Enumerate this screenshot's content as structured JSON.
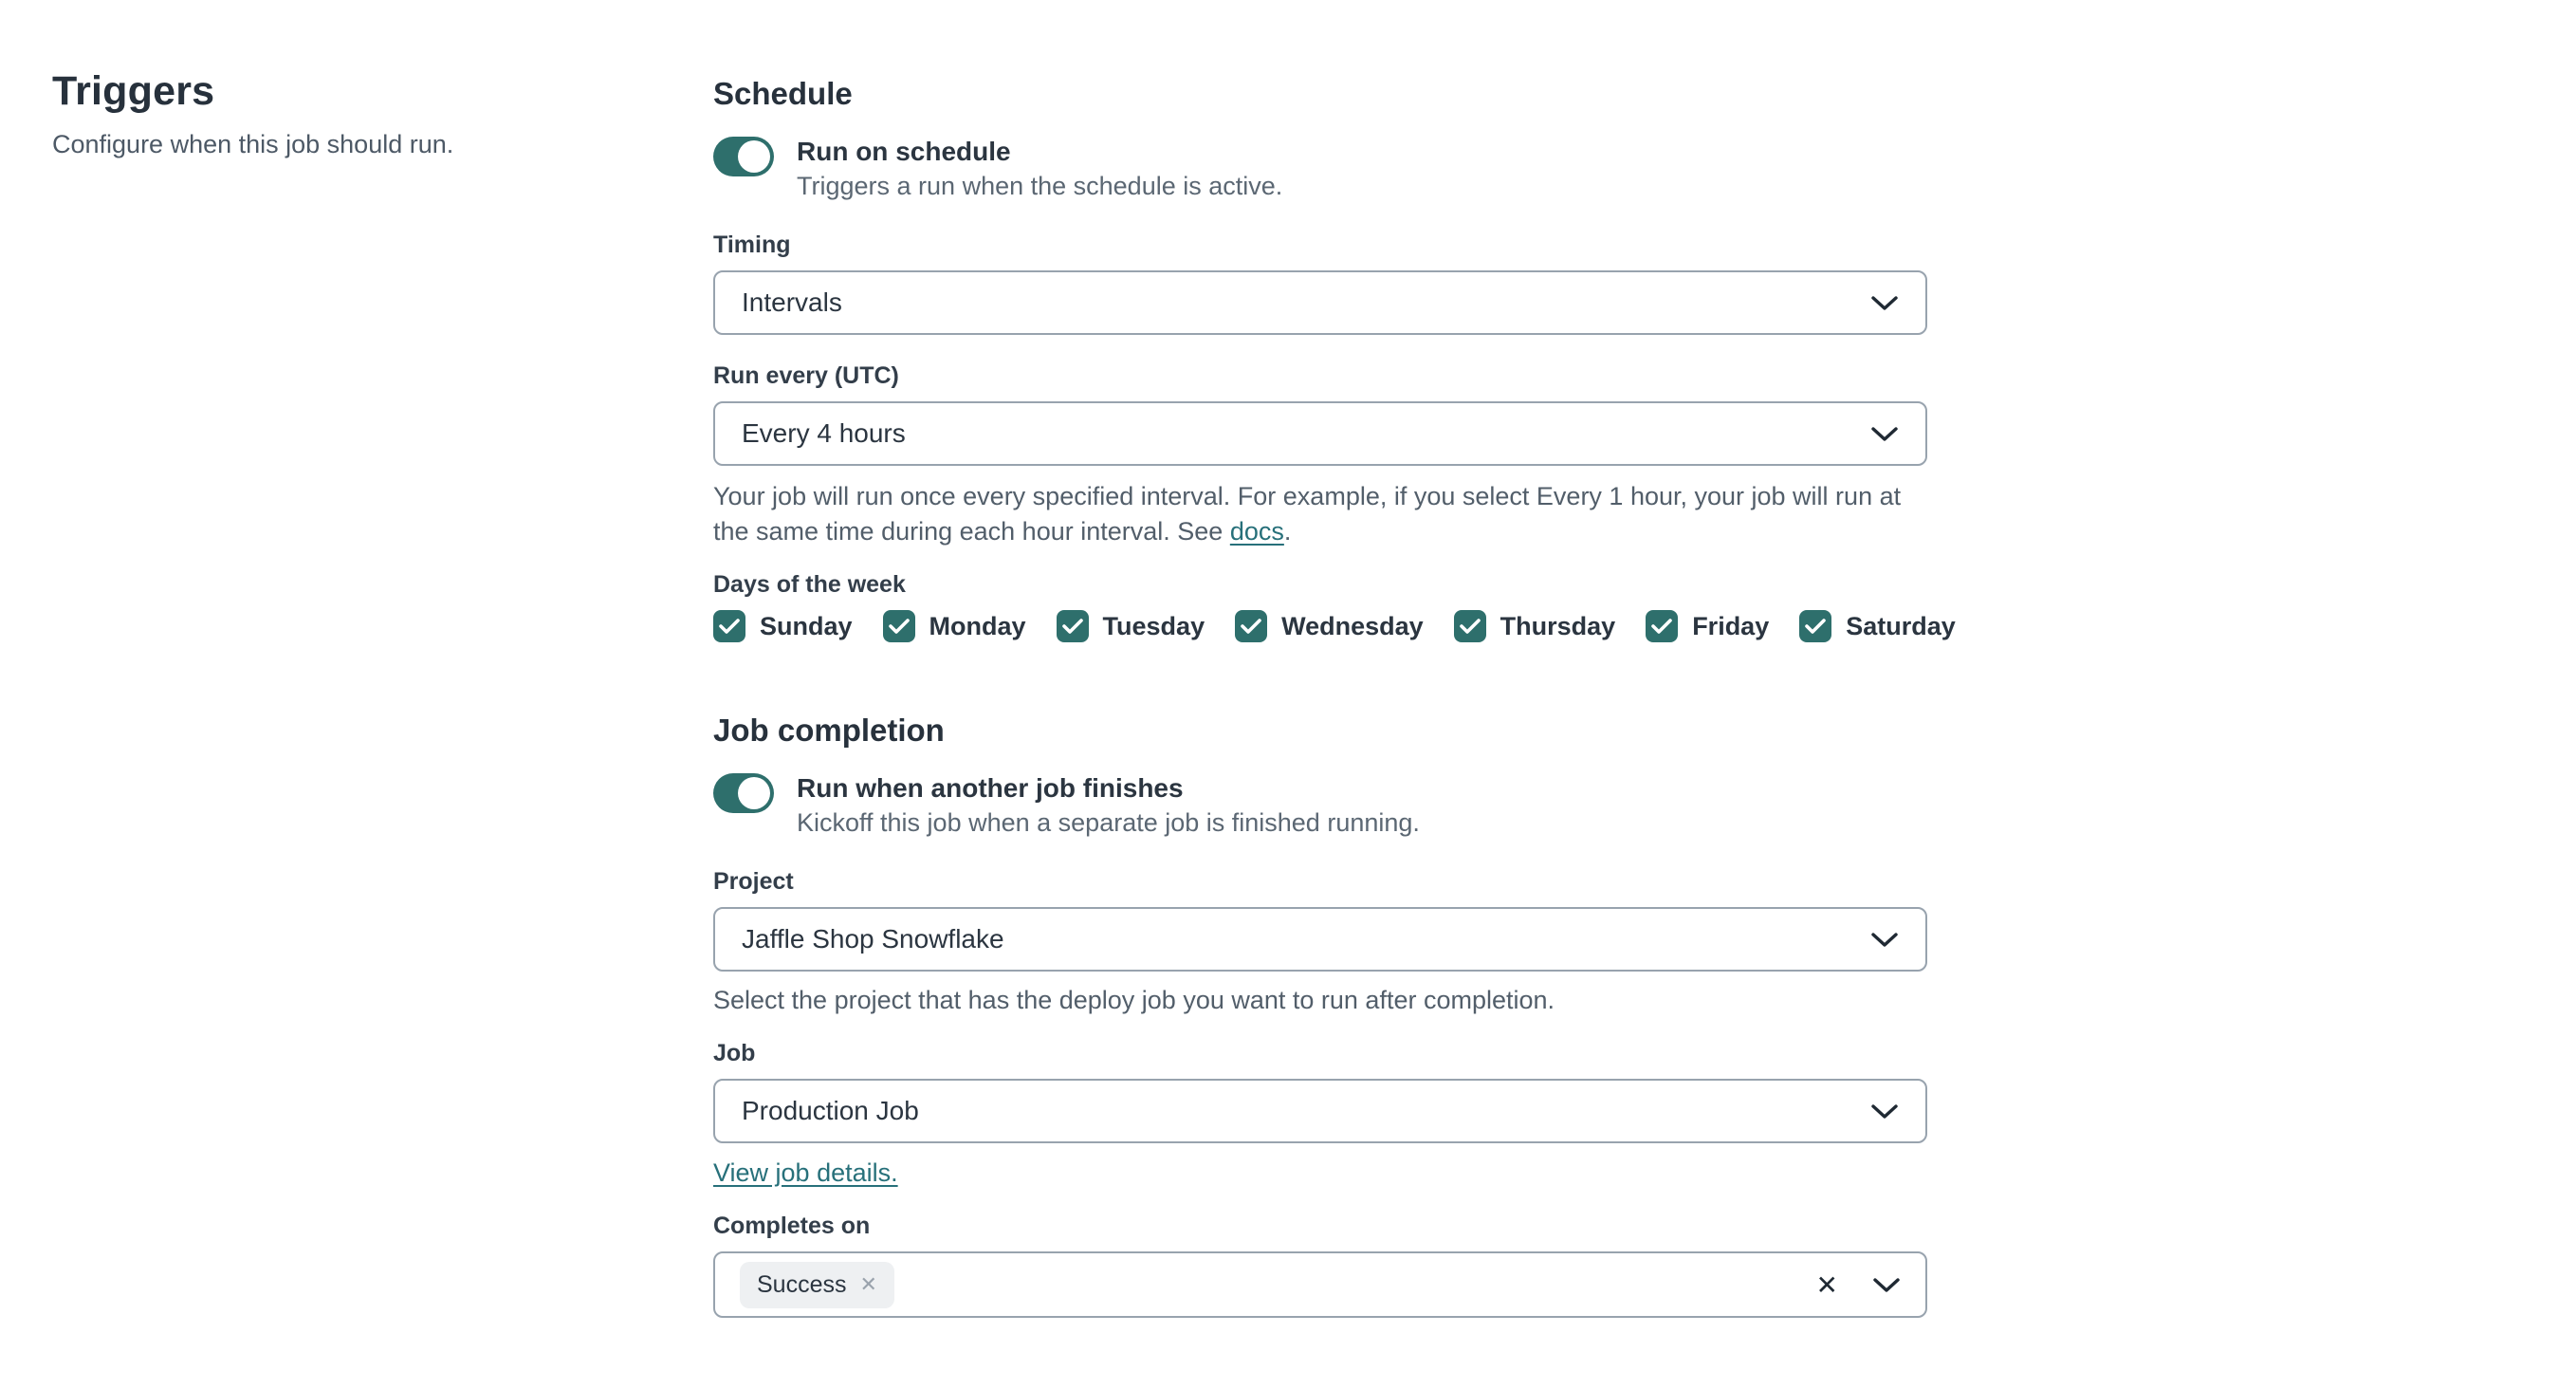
{
  "sidebar": {
    "title": "Triggers",
    "description": "Configure when this job should run."
  },
  "schedule": {
    "heading": "Schedule",
    "toggle": {
      "state": "on",
      "label": "Run on schedule",
      "description": "Triggers a run when the schedule is active."
    },
    "timing": {
      "label": "Timing",
      "value": "Intervals"
    },
    "run_every": {
      "label": "Run every (UTC)",
      "value": "Every 4 hours",
      "help_prefix": "Your job will run once every specified interval. For example, if you select Every 1 hour, your job will run at the same time during each hour interval. See ",
      "help_link": "docs",
      "help_suffix": "."
    },
    "days": {
      "label": "Days of the week",
      "items": [
        {
          "label": "Sunday",
          "checked": true
        },
        {
          "label": "Monday",
          "checked": true
        },
        {
          "label": "Tuesday",
          "checked": true
        },
        {
          "label": "Wednesday",
          "checked": true
        },
        {
          "label": "Thursday",
          "checked": true
        },
        {
          "label": "Friday",
          "checked": true
        },
        {
          "label": "Saturday",
          "checked": true
        }
      ]
    }
  },
  "job_completion": {
    "heading": "Job completion",
    "toggle": {
      "state": "on",
      "label": "Run when another job finishes",
      "description": "Kickoff this job when a separate job is finished running."
    },
    "project": {
      "label": "Project",
      "value": "Jaffle Shop Snowflake",
      "help": "Select the project that has the deploy job you want to run after completion."
    },
    "job": {
      "label": "Job",
      "value": "Production Job",
      "link": "View job details."
    },
    "completes_on": {
      "label": "Completes on",
      "chips": [
        "Success"
      ],
      "chip_remove_icon": "✕",
      "clear_icon": "✕"
    }
  },
  "colors": {
    "accent_teal": "#2e6f6c",
    "link_teal": "#27707a",
    "heading": "#27313c",
    "muted_text": "#525e6a",
    "field_border": "#98a3ae",
    "chip_bg": "#eef0f2"
  }
}
